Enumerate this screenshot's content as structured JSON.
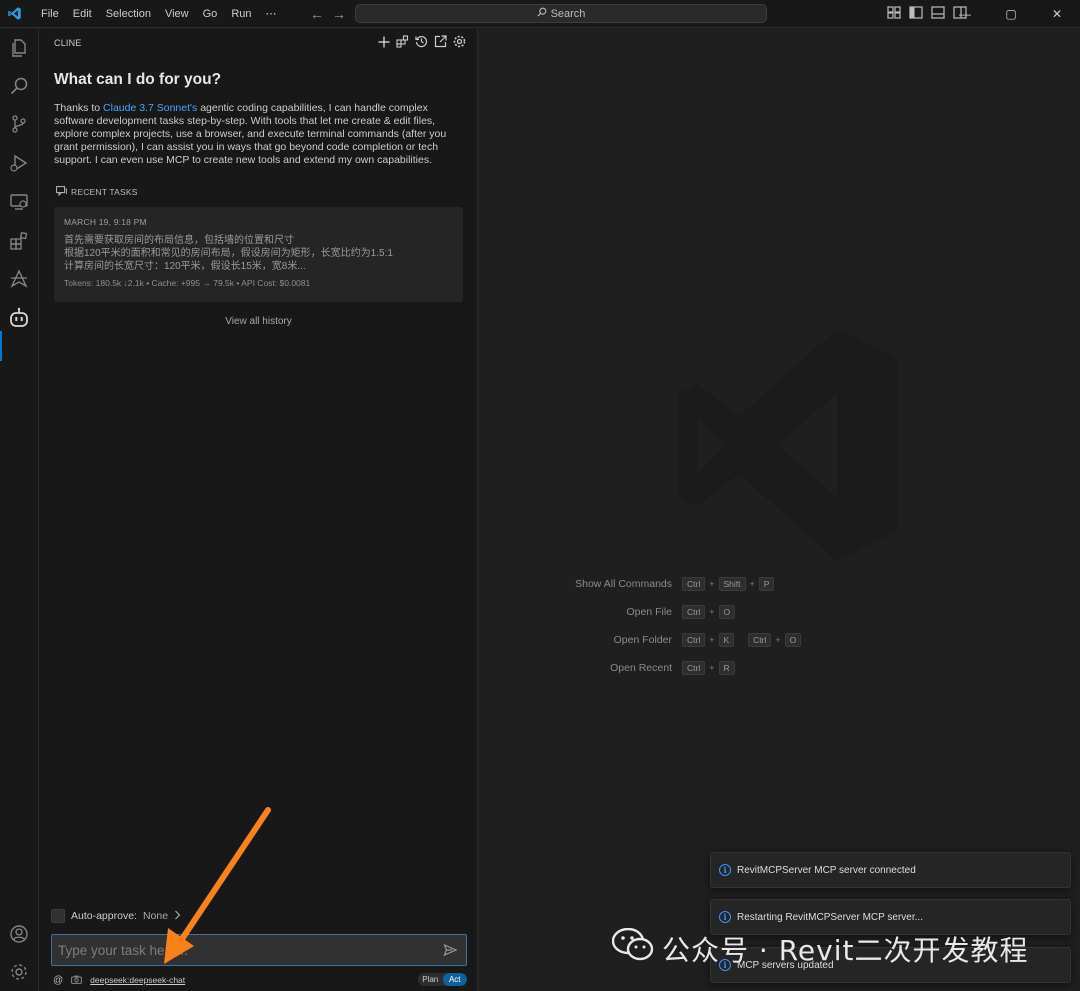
{
  "menu": [
    "File",
    "Edit",
    "Selection",
    "View",
    "Go",
    "Run",
    "⋯"
  ],
  "search": {
    "label": "Search"
  },
  "window_controls": {
    "minimize": "—",
    "maximize": "▢",
    "close": "✕"
  },
  "activity_icons": [
    "files-icon",
    "search-icon",
    "source-control-icon",
    "run-debug-icon",
    "remote-explorer-icon",
    "extensions-icon",
    "deploy-icon",
    "cline-robot-icon",
    "account-icon",
    "settings-gear-icon"
  ],
  "cline": {
    "header": "CLINE",
    "title": "What can I do for you?",
    "intro_before": "Thanks to ",
    "intro_link": "Claude 3.7 Sonnet's",
    "intro_after": " agentic coding capabilities, I can handle complex software development tasks step-by-step. With tools that let me create & edit files, explore complex projects, use a browser, and execute terminal commands (after you grant permission), I can assist you in ways that go beyond code completion or tech support. I can even use MCP to create new tools and extend my own capabilities.",
    "recent_label": "RECENT TASKS",
    "task": {
      "date": "MARCH 19, 9:18 PM",
      "text": "首先需要获取房间的布局信息，包括墙的位置和尺寸\n根据120平米的面积和常见的房间布局，假设房间为矩形，长宽比约为1.5:1\n计算房间的长宽尺寸：120平米，假设长15米，宽8米...",
      "meta": "Tokens: 180.5k ↓2.1k • Cache: +995 → 79.5k • API Cost: $0.0081"
    },
    "view_history": "View all history",
    "auto_approve_label": "Auto-approve:",
    "auto_approve_value": "None",
    "input_placeholder": "Type your task here...",
    "model": "deepseek:deepseek-chat",
    "mode_plan": "Plan",
    "mode_act": "Act",
    "mode_selected": "Act"
  },
  "shortcuts": [
    {
      "label": "Show All Commands",
      "keys": [
        [
          "Ctrl",
          "Shift",
          "P"
        ]
      ]
    },
    {
      "label": "Open File",
      "keys": [
        [
          "Ctrl",
          "O"
        ]
      ]
    },
    {
      "label": "Open Folder",
      "keys": [
        [
          "Ctrl",
          "K"
        ],
        [
          "Ctrl",
          "O"
        ]
      ]
    },
    {
      "label": "Open Recent",
      "keys": [
        [
          "Ctrl",
          "R"
        ]
      ]
    }
  ],
  "notifications": [
    "RevitMCPServer MCP server connected",
    "Restarting RevitMCPServer MCP server...",
    "MCP servers updated"
  ],
  "overlay_watermark": "公众号 · Revit二次开发教程",
  "colors": {
    "accent": "#0078d4",
    "link": "#4aa3ff",
    "arrow": "#f7821b",
    "info": "#3794ff"
  }
}
